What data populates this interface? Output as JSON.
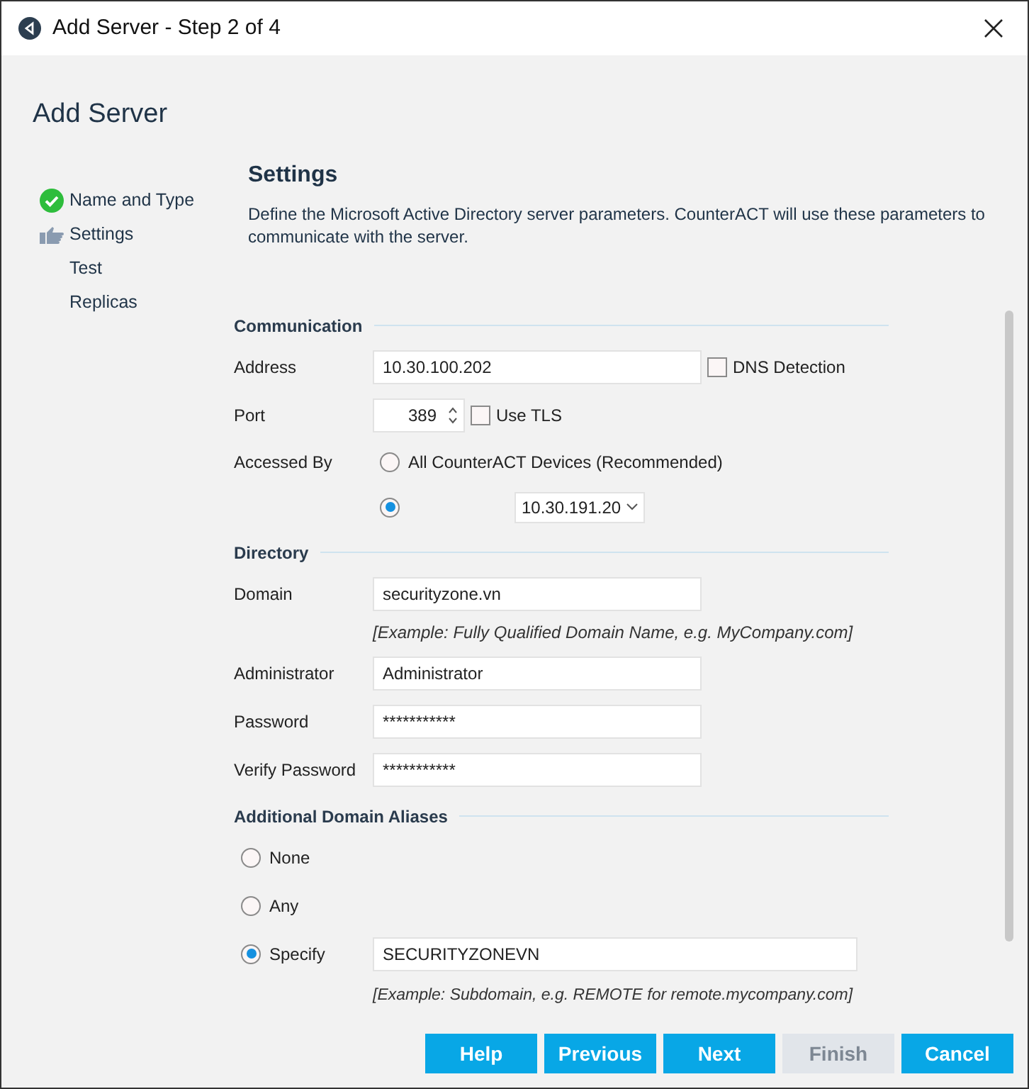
{
  "window": {
    "title": "Add Server - Step 2 of 4"
  },
  "heading": "Add Server",
  "steps": [
    {
      "label": "Name and Type",
      "completed": true,
      "selected": false
    },
    {
      "label": "Settings",
      "completed": false,
      "selected": true
    },
    {
      "label": "Test",
      "completed": false,
      "selected": false
    },
    {
      "label": "Replicas",
      "completed": false,
      "selected": false
    }
  ],
  "page": {
    "title": "Settings",
    "description": "Define the Microsoft Active Directory server parameters. CounterACT will use these parameters to communicate with the server."
  },
  "communication": {
    "title": "Communication",
    "address": {
      "label": "Address",
      "value": "10.30.100.202",
      "option": {
        "label": "DNS Detection",
        "checked": false
      }
    },
    "port": {
      "label": "Port",
      "value": "389",
      "option": {
        "label": "Use TLS",
        "checked": false
      }
    },
    "accessed_by": {
      "label": "Accessed By",
      "options": [
        {
          "label": "All CounterACT Devices (Recommended)",
          "selected": false
        },
        {
          "device": "10.30.191.20",
          "selected": true
        }
      ]
    }
  },
  "directory": {
    "title": "Directory",
    "fields": [
      {
        "label": "Domain",
        "value": "securityzone.vn",
        "hint": "[Example: Fully Qualified Domain Name, e.g. MyCompany.com]"
      },
      {
        "label": "Administrator",
        "value": "Administrator"
      },
      {
        "label": "Password",
        "value": "***********"
      },
      {
        "label": "Verify Password",
        "value": "***********"
      }
    ]
  },
  "aliases": {
    "title": "Additional Domain Aliases",
    "options": [
      {
        "label": "None",
        "selected": false
      },
      {
        "label": "Any",
        "selected": false
      },
      {
        "label": "Specify",
        "selected": true,
        "value": "SECURITYZONEVN"
      }
    ],
    "hint": "[Example: Subdomain, e.g. REMOTE for remote.mycompany.com]"
  },
  "buttons": [
    {
      "label": "Help",
      "disabled": false
    },
    {
      "label": "Previous",
      "disabled": false
    },
    {
      "label": "Next",
      "disabled": false
    },
    {
      "label": "Finish",
      "disabled": true
    },
    {
      "label": "Cancel",
      "disabled": false
    }
  ]
}
